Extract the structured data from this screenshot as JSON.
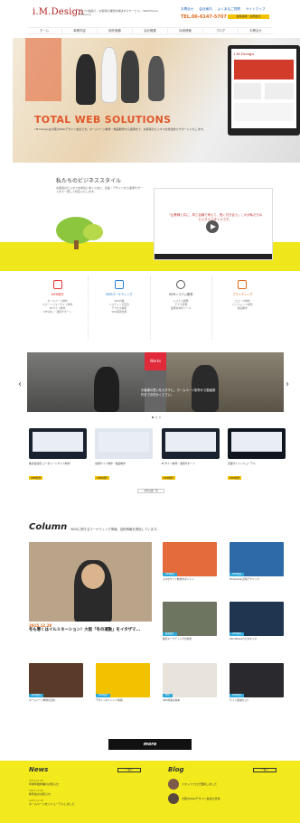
{
  "header": {
    "logo": "i.M.Design",
    "tagline": "ウェブ×動画で、お客様の課題を解決するサービス。(Web/Movie Solutions)",
    "links": [
      "お問合せ",
      "会社案内",
      "よくあるご質問",
      "サイトマップ"
    ],
    "phone": "TEL.06-6147-5707",
    "cta": "資料請求・お問合せ"
  },
  "nav": [
    "ホーム",
    "事業内容",
    "制作実績",
    "会社概要",
    "採用情報",
    "ブログ",
    "お問合せ"
  ],
  "hero": {
    "title": "TOTAL WEB SOLUTIONS",
    "body": "i.M.Designは大阪のWebデザイン会社です。ホームページ制作・動画制作から運用まで、お客様のビジネスを総合的にサポートいたします。",
    "screen_label": "i.M.Design"
  },
  "business": {
    "title": "私たちのビジネススタイル",
    "body": "お客様のビジネスを成功に導くために、企画・デザインから運用サポートまで一貫して対応いたします。",
    "video_text": "「企業様と共に、同じ目線で考えて、長く付き合う」これが私たちのビジネススタイルです。"
  },
  "services": [
    {
      "title": "WEB制作",
      "lines": [
        "ホームページ制作",
        "スマートフォンサイト制作",
        "ECサイト制作",
        "CMS導入・運用サポート"
      ]
    },
    {
      "title": "WEBマーケティング",
      "lines": [
        "SEO対策",
        "リスティング広告",
        "アクセス解析",
        "SNS運用支援"
      ]
    },
    {
      "title": "WEBシステム開発",
      "lines": [
        "システム開発",
        "アプリ開発",
        "業務効率化ツール"
      ]
    },
    {
      "title": "ブランディング",
      "lines": [
        "ロゴ・CI制作",
        "パンフレット制作",
        "動画制作"
      ]
    }
  ],
  "works": {
    "badge": "Works",
    "caption": "お客様の思いをカタチに。ホームページ制作から動画制作までお任せください。",
    "items": [
      {
        "caption": "株式会社様 コーポレートサイト制作",
        "tag": "WEB制作"
      },
      {
        "caption": "採用サイト制作・動画制作",
        "tag": "WEB制作"
      },
      {
        "caption": "ECサイト制作・運用サポート",
        "tag": "WEB制作"
      },
      {
        "caption": "店舗サイトリニューアル",
        "tag": "WEB制作"
      }
    ],
    "list_label": "制作実績一覧"
  },
  "column": {
    "title": "Column",
    "subtitle": "WEBに関するマーケティング情報、技術情報を発信しています。",
    "feature_date": "2015.12.28",
    "feature_title": "冬も寒くはイルミネーション！大阪「冬の運動」をイタザマ...",
    "items": [
      {
        "tag": "WEB制作",
        "caption": "スマホサイト制作のポイント"
      },
      {
        "tag": "WEB制作",
        "caption": "Photoshop活用テクニック"
      },
      {
        "tag": "動画制作",
        "caption": "動画マーケティングの効果"
      },
      {
        "tag": "WEB制作",
        "caption": "WordPressカスタマイズ"
      },
      {
        "tag": "WEB制作",
        "caption": "ホームページ制作の流れ"
      },
      {
        "tag": "WEB制作",
        "caption": "デザインのトレンド情報"
      },
      {
        "tag": "SEO",
        "caption": "SEO対策の基本"
      },
      {
        "tag": "WEB制作",
        "caption": "サイト運用のコツ"
      }
    ],
    "more": "more"
  },
  "footer": {
    "news_title": "News",
    "news_btn": "一覧へ",
    "news": [
      {
        "date": "2016.01.08",
        "text": "年末年始休業のお知らせ"
      },
      {
        "date": "2015.12.25",
        "text": "新年会のお知らせ"
      },
      {
        "date": "2015.12.10",
        "text": "ホームページをリニューアルしました"
      }
    ],
    "blog_title": "Blog",
    "blog_btn": "一覧へ",
    "blog": [
      {
        "text": "スタッフブログ更新しました"
      },
      {
        "text": "大阪のWebデザイン会社の日常"
      }
    ]
  },
  "colors": {
    "accent": "#e0572b",
    "yellow": "#f0e61c",
    "red": "#e02a3a",
    "blue": "#2da8d8"
  }
}
